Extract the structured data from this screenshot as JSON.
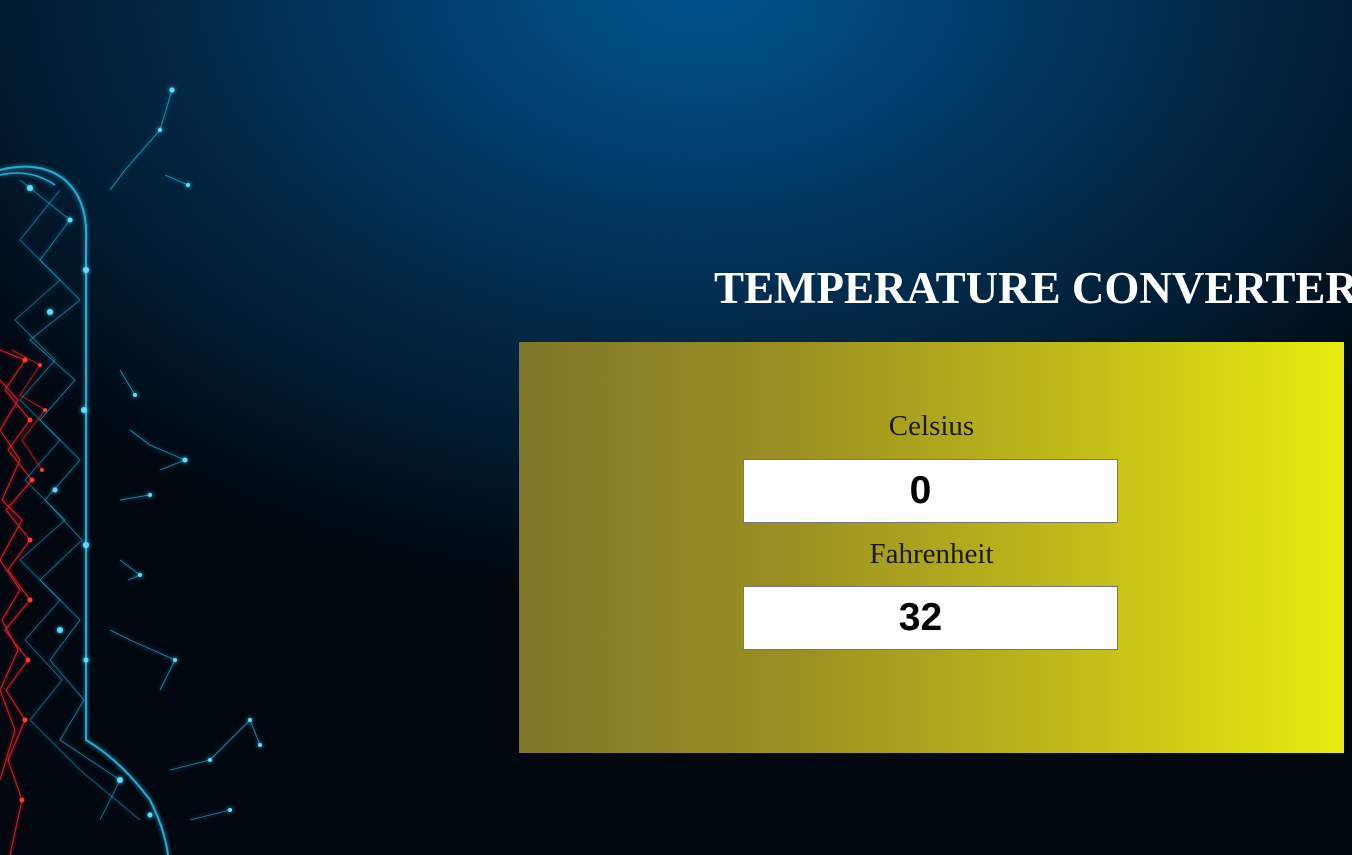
{
  "page": {
    "title": "TEMPERATURE CONVERTER"
  },
  "converter": {
    "celsius": {
      "label": "Celsius",
      "value": "0"
    },
    "fahrenheit": {
      "label": "Fahrenheit",
      "value": "32"
    }
  },
  "colors": {
    "panel_gradient_start": "#80762a",
    "panel_gradient_end": "#e7ec0f",
    "title_color": "#ffffff",
    "background_top": "#00558f",
    "background_bottom": "#00070f"
  }
}
